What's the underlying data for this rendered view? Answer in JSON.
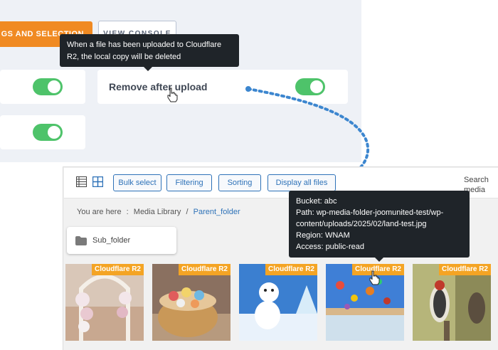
{
  "settings": {
    "tab_button_label": "GS AND SELECTION",
    "console_button_label": "VIEW CONSOLE",
    "remove_after_upload_label": "Remove after upload",
    "tooltip_text": "When a file has been uploaded to Cloudflare R2, the local copy will be deleted"
  },
  "toolbar": {
    "bulk_select": "Bulk select",
    "filtering": "Filtering",
    "sorting": "Sorting",
    "display_all": "Display all files",
    "search_label": "Search media"
  },
  "breadcrumb": {
    "prefix": "You are here",
    "sep1": ":",
    "root": "Media Library",
    "sep2": "/",
    "current": "Parent_folder"
  },
  "folder": {
    "name": "Sub_folder"
  },
  "info_tooltip": {
    "bucket": "Bucket: abc",
    "path_line1": "Path: wp-media-folder-joomunited-test/wp-",
    "path_line2": "content/uploads/2025/02/land-test.jpg",
    "region": "Region: WNAM",
    "access": "Access: public-read"
  },
  "thumbnails": [
    {
      "badge": "Cloudflare R2",
      "subject": "floral wedding arch"
    },
    {
      "badge": "Cloudflare R2",
      "subject": "basket of treats"
    },
    {
      "badge": "Cloudflare R2",
      "subject": "snowman"
    },
    {
      "badge": "Cloudflare R2",
      "subject": "hot air balloons"
    },
    {
      "badge": "Cloudflare R2",
      "subject": "woodpecker bird"
    }
  ],
  "colors": {
    "accent_orange": "#f08a22",
    "toggle_green": "#4ec36a",
    "link_blue": "#2e72b8",
    "badge_orange": "#f4a424",
    "tooltip_bg": "#1f2429",
    "connector_blue": "#3c86cf"
  }
}
